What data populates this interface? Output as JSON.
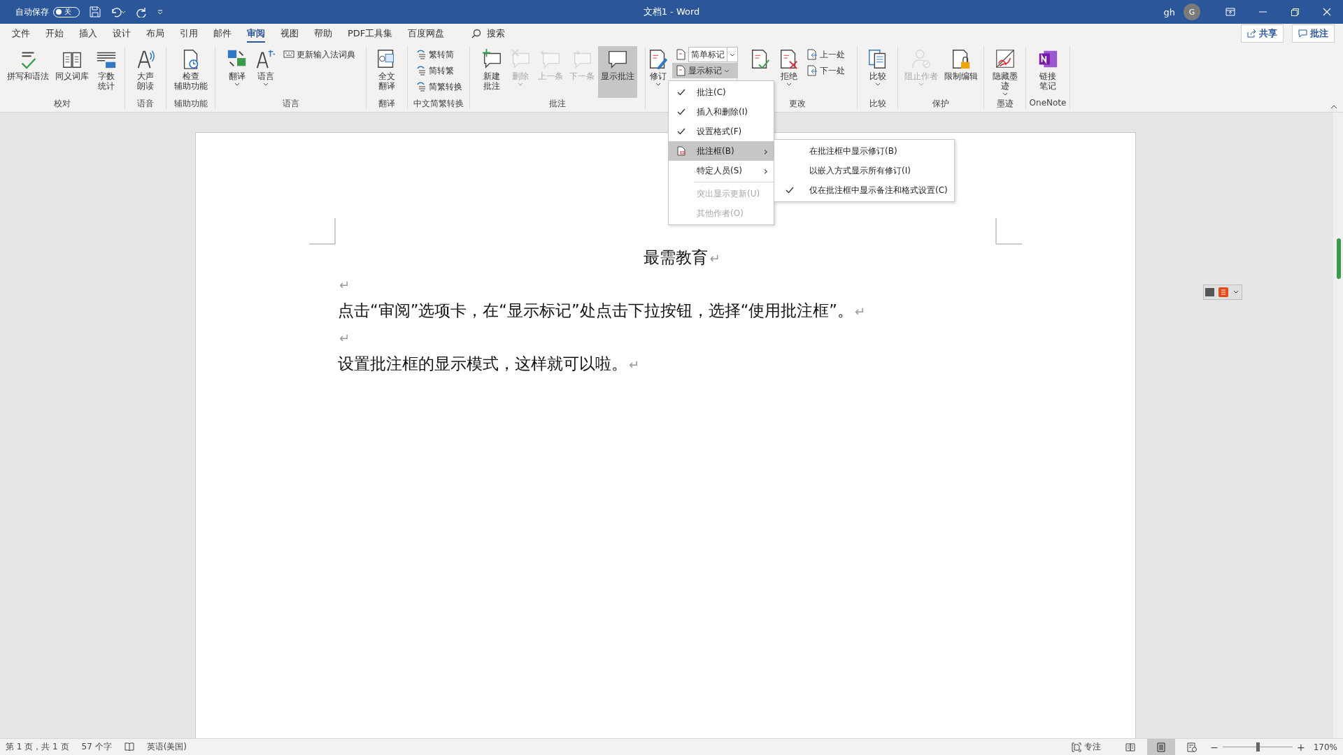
{
  "title_bar": {
    "autosave_label": "自动保存",
    "autosave_toggle": {
      "on": false,
      "label": "关"
    },
    "document_title": "文档1  -  Word",
    "user_name": "gh",
    "avatar_initial": "G"
  },
  "tabs": [
    {
      "label": "文件",
      "selected": false
    },
    {
      "label": "开始",
      "selected": false
    },
    {
      "label": "插入",
      "selected": false
    },
    {
      "label": "设计",
      "selected": false
    },
    {
      "label": "布局",
      "selected": false
    },
    {
      "label": "引用",
      "selected": false
    },
    {
      "label": "邮件",
      "selected": false
    },
    {
      "label": "审阅",
      "selected": true
    },
    {
      "label": "视图",
      "selected": false
    },
    {
      "label": "帮助",
      "selected": false
    },
    {
      "label": "PDF工具集",
      "selected": false
    },
    {
      "label": "百度网盘",
      "selected": false
    }
  ],
  "search": {
    "label": "搜索"
  },
  "share_button": "共享",
  "comments_button": "批注",
  "ribbon": [
    {
      "label": "校对",
      "items": [
        {
          "kind": "large",
          "label": "拼写和语法",
          "dropdown": false,
          "disabled": false,
          "pressed": false
        },
        {
          "kind": "large",
          "label": "同义词库",
          "dropdown": false,
          "disabled": false,
          "pressed": false
        },
        {
          "kind": "large",
          "lines": [
            "字数",
            "统计"
          ],
          "dropdown": false,
          "disabled": false,
          "pressed": false
        }
      ]
    },
    {
      "label": "语音",
      "items": [
        {
          "kind": "large",
          "lines": [
            "大声",
            "朗读"
          ],
          "dropdown": false,
          "disabled": false,
          "pressed": false
        }
      ]
    },
    {
      "label": "辅助功能",
      "items": [
        {
          "kind": "large",
          "lines": [
            "检查",
            "辅助功能"
          ],
          "dropdown": false,
          "disabled": false,
          "pressed": false
        }
      ]
    },
    {
      "label": "语言",
      "items": [
        {
          "kind": "large",
          "label": "翻译",
          "dropdown": true,
          "disabled": false,
          "pressed": false
        },
        {
          "kind": "large",
          "label": "语言",
          "dropdown": true,
          "disabled": false,
          "pressed": false
        },
        {
          "kind": "small",
          "label": "更新输入法词典",
          "dropdown": false,
          "disabled": false,
          "pressed": false
        }
      ]
    },
    {
      "label": "翻译",
      "items": [
        {
          "kind": "large",
          "lines": [
            "全文",
            "翻译"
          ],
          "dropdown": false,
          "disabled": false,
          "pressed": false
        }
      ]
    },
    {
      "label": "中文简繁转换",
      "items": [
        {
          "kind": "small",
          "label": "繁转简",
          "dropdown": false,
          "disabled": false,
          "pressed": false
        },
        {
          "kind": "small",
          "label": "简转繁",
          "dropdown": false,
          "disabled": false,
          "pressed": false
        },
        {
          "kind": "small",
          "label": "简繁转换",
          "dropdown": false,
          "disabled": false,
          "pressed": false
        }
      ]
    },
    {
      "label": "批注",
      "items": [
        {
          "kind": "large",
          "lines": [
            "新建",
            "批注"
          ],
          "dropdown": false,
          "disabled": false,
          "pressed": false
        },
        {
          "kind": "large",
          "label": "删除",
          "dropdown": true,
          "disabled": true,
          "pressed": false
        },
        {
          "kind": "large",
          "label": "上一条",
          "dropdown": false,
          "disabled": true,
          "pressed": false
        },
        {
          "kind": "large",
          "label": "下一条",
          "dropdown": false,
          "disabled": true,
          "pressed": false
        },
        {
          "kind": "large",
          "label": "显示批注",
          "dropdown": false,
          "disabled": false,
          "pressed": true
        }
      ]
    },
    {
      "items": [
        {
          "kind": "large",
          "label": "修订",
          "dropdown": true,
          "disabled": false,
          "pressed": false
        },
        {
          "kind": "combo",
          "label": "简单标记",
          "dropdown": true,
          "disabled": false,
          "pressed": false
        },
        {
          "kind": "small",
          "label": "显示标记",
          "dropdown": true,
          "disabled": false,
          "pressed": true
        }
      ]
    },
    {
      "label": "更改",
      "items": [
        {
          "kind": "large",
          "dropdown": false,
          "disabled": false,
          "pressed": false
        },
        {
          "kind": "large",
          "label": "拒绝",
          "dropdown": true,
          "disabled": false,
          "pressed": false
        },
        {
          "kind": "small",
          "label": "上一处",
          "dropdown": false,
          "disabled": false,
          "pressed": false
        },
        {
          "kind": "small",
          "label": "下一处",
          "dropdown": false,
          "disabled": false,
          "pressed": false
        }
      ]
    },
    {
      "label": "比较",
      "items": [
        {
          "kind": "large",
          "label": "比较",
          "dropdown": true,
          "disabled": false,
          "pressed": false
        }
      ]
    },
    {
      "label": "保护",
      "items": [
        {
          "kind": "large",
          "label": "阻止作者",
          "dropdown": true,
          "disabled": true,
          "pressed": false
        },
        {
          "kind": "large",
          "label": "限制编辑",
          "dropdown": false,
          "disabled": false,
          "pressed": false
        }
      ]
    },
    {
      "label": "墨迹",
      "items": [
        {
          "kind": "large",
          "lines": [
            "隐藏墨",
            "迹"
          ],
          "dropdown": true,
          "disabled": false,
          "pressed": false
        }
      ]
    },
    {
      "label": "OneNote",
      "items": [
        {
          "kind": "large",
          "lines": [
            "链接",
            "笔记"
          ],
          "dropdown": false,
          "disabled": false,
          "pressed": false
        }
      ]
    }
  ],
  "markup_menu": {
    "items": [
      {
        "kind": "check",
        "label": "批注(C)",
        "checked": true,
        "disabled": false,
        "selected": false
      },
      {
        "kind": "check",
        "label": "插入和删除(I)",
        "checked": true,
        "disabled": false,
        "selected": false
      },
      {
        "kind": "check",
        "label": "设置格式(F)",
        "checked": true,
        "disabled": false,
        "selected": false
      },
      {
        "kind": "submenu",
        "label": "批注框(B)",
        "checked": false,
        "disabled": false,
        "selected": true,
        "arrow": "›"
      },
      {
        "kind": "submenu",
        "label": "特定人员(S)",
        "checked": false,
        "disabled": false,
        "selected": false,
        "arrow": "›"
      },
      {
        "kind": "separator"
      },
      {
        "kind": "check",
        "label": "突出显示更新(U)",
        "checked": false,
        "disabled": true,
        "selected": false
      },
      {
        "kind": "check",
        "label": "其他作者(O)",
        "checked": false,
        "disabled": true,
        "selected": false
      }
    ]
  },
  "balloons_submenu": {
    "items": [
      {
        "label": "在批注框中显示修订(B)",
        "checked": false
      },
      {
        "label": "以嵌入方式显示所有修订(I)",
        "checked": false
      },
      {
        "label": "仅在批注框中显示备注和格式设置(C)",
        "checked": true
      }
    ]
  },
  "document": {
    "heading": {
      "text": "最需教育",
      "mark": "↵"
    },
    "paragraphs": [
      {
        "mark": "↵"
      },
      {
        "text": "点击“审阅”选项卡，在“显示标记”处点击下拉按钮，选择“使用批注框”。",
        "mark": "↵"
      },
      {
        "mark": "↵"
      },
      {
        "text": "设置批注框的显示模式，这样就可以啦。",
        "mark": "↵"
      }
    ]
  },
  "status_bar": {
    "page": "第 1 页，共 1 页",
    "words": "57 个字",
    "language": "英语(美国)",
    "focus": "专注",
    "views": [
      {
        "selected": false
      },
      {
        "selected": true
      },
      {
        "selected": false
      }
    ],
    "zoom_minus": "−",
    "zoom_plus": "+",
    "zoom": {
      "level": 0.5
    },
    "zoom_reading": "170%"
  }
}
